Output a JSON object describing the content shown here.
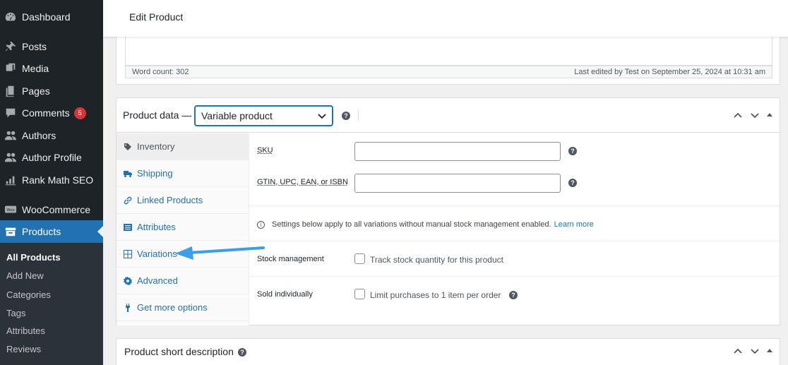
{
  "sidebar": {
    "items": [
      {
        "label": "Dashboard",
        "icon": "dashboard-icon"
      },
      {
        "label": "Posts",
        "icon": "pin-icon"
      },
      {
        "label": "Media",
        "icon": "media-icon"
      },
      {
        "label": "Pages",
        "icon": "pages-icon"
      },
      {
        "label": "Comments",
        "icon": "comment-icon",
        "badge": "5"
      },
      {
        "label": "Authors",
        "icon": "users-icon"
      },
      {
        "label": "Author Profile",
        "icon": "users-icon"
      },
      {
        "label": "Rank Math SEO",
        "icon": "chart-icon"
      },
      {
        "label": "WooCommerce",
        "icon": "woo-icon"
      },
      {
        "label": "Products",
        "icon": "archive-icon",
        "active": true
      }
    ],
    "submenu": [
      {
        "label": "All Products",
        "current": true
      },
      {
        "label": "Add New"
      },
      {
        "label": "Categories"
      },
      {
        "label": "Tags"
      },
      {
        "label": "Attributes"
      },
      {
        "label": "Reviews"
      }
    ]
  },
  "header": {
    "title": "Edit Product"
  },
  "editor": {
    "word_count": "Word count: 302",
    "last_edited": "Last edited by Test on September 25, 2024 at 10:31 am"
  },
  "product_data": {
    "title": "Product data —",
    "product_type": "Variable product",
    "tabs": [
      {
        "label": "Inventory",
        "icon": "tag-icon",
        "active": true
      },
      {
        "label": "Shipping",
        "icon": "truck-icon"
      },
      {
        "label": "Linked Products",
        "icon": "link-icon"
      },
      {
        "label": "Attributes",
        "icon": "list-icon"
      },
      {
        "label": "Variations",
        "icon": "grid-icon"
      },
      {
        "label": "Advanced",
        "icon": "gear-icon"
      },
      {
        "label": "Get more options",
        "icon": "plugin-icon"
      }
    ],
    "fields": {
      "sku_label": "SKU",
      "gtin_label": "GTIN, UPC, EAN, or ISBN",
      "notice_text": "Settings below apply to all variations without manual stock management enabled.",
      "learn_more": "Learn more",
      "stock_label": "Stock management",
      "stock_checkbox": "Track stock quantity for this product",
      "sold_label": "Sold individually",
      "sold_checkbox": "Limit purchases to 1 item per order"
    }
  },
  "short_description": {
    "title": "Product short description"
  },
  "colors": {
    "accent": "#2271b1",
    "sidebar": "#1d2327",
    "badge": "#d63638",
    "arrow": "#3a9ee8"
  }
}
